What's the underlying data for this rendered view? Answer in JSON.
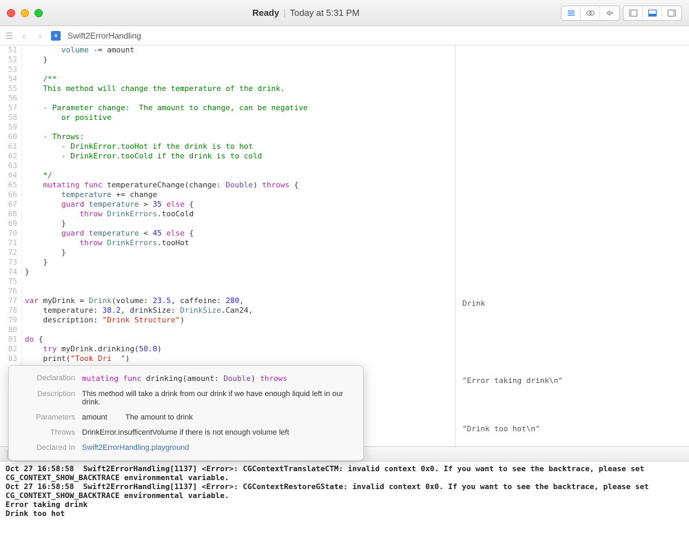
{
  "titlebar": {
    "status": "Ready",
    "time": "Today at 5:31 PM"
  },
  "tab": {
    "filename": "Swift2ErrorHandling"
  },
  "gutter_start": 51,
  "gutter_end": 83,
  "code_lines": [
    {
      "indent": 8,
      "tokens": [
        {
          "t": "volume ",
          "c": "prop"
        },
        {
          "t": "-= amount"
        }
      ]
    },
    {
      "indent": 4,
      "tokens": [
        {
          "t": "}"
        }
      ]
    },
    {
      "indent": 0,
      "tokens": []
    },
    {
      "indent": 4,
      "tokens": [
        {
          "t": "/**",
          "c": "doc"
        }
      ]
    },
    {
      "indent": 4,
      "tokens": [
        {
          "t": "This method will change the temperature of the drink.",
          "c": "doc"
        }
      ]
    },
    {
      "indent": 0,
      "tokens": []
    },
    {
      "indent": 4,
      "tokens": [
        {
          "t": "- Parameter change:  The amount to change, can be negative",
          "c": "doc"
        }
      ]
    },
    {
      "indent": 8,
      "tokens": [
        {
          "t": "or positive",
          "c": "doc"
        }
      ]
    },
    {
      "indent": 0,
      "tokens": []
    },
    {
      "indent": 4,
      "tokens": [
        {
          "t": "- Throws:",
          "c": "doc"
        }
      ]
    },
    {
      "indent": 8,
      "tokens": [
        {
          "t": "- DrinkError.tooHot if the drink is to hot",
          "c": "doc"
        }
      ]
    },
    {
      "indent": 8,
      "tokens": [
        {
          "t": "- DrinkError.tooCold if the drink is to cold",
          "c": "doc"
        }
      ]
    },
    {
      "indent": 0,
      "tokens": []
    },
    {
      "indent": 4,
      "tokens": [
        {
          "t": "*/",
          "c": "doc"
        }
      ]
    },
    {
      "indent": 4,
      "tokens": [
        {
          "t": "mutating func ",
          "c": "kw"
        },
        {
          "t": "temperatureChange(change: "
        },
        {
          "t": "Double",
          "c": "type"
        },
        {
          "t": ") "
        },
        {
          "t": "throws",
          "c": "kw"
        },
        {
          "t": " {"
        }
      ]
    },
    {
      "indent": 8,
      "tokens": [
        {
          "t": "temperature ",
          "c": "prop"
        },
        {
          "t": "+= change"
        }
      ]
    },
    {
      "indent": 8,
      "tokens": [
        {
          "t": "guard ",
          "c": "kw"
        },
        {
          "t": "temperature",
          "c": "prop"
        },
        {
          "t": " > "
        },
        {
          "t": "35",
          "c": "num"
        },
        {
          "t": " "
        },
        {
          "t": "else",
          "c": "kw"
        },
        {
          "t": " {"
        }
      ]
    },
    {
      "indent": 12,
      "tokens": [
        {
          "t": "throw ",
          "c": "kw"
        },
        {
          "t": "DrinkErrors",
          "c": "usertype"
        },
        {
          "t": ".tooCold"
        }
      ]
    },
    {
      "indent": 8,
      "tokens": [
        {
          "t": "}"
        }
      ]
    },
    {
      "indent": 8,
      "tokens": [
        {
          "t": "guard ",
          "c": "kw"
        },
        {
          "t": "temperature",
          "c": "prop"
        },
        {
          "t": " < "
        },
        {
          "t": "45",
          "c": "num"
        },
        {
          "t": " "
        },
        {
          "t": "else",
          "c": "kw"
        },
        {
          "t": " {"
        }
      ]
    },
    {
      "indent": 12,
      "tokens": [
        {
          "t": "throw ",
          "c": "kw"
        },
        {
          "t": "DrinkErrors",
          "c": "usertype"
        },
        {
          "t": ".tooHot"
        }
      ]
    },
    {
      "indent": 8,
      "tokens": [
        {
          "t": "}"
        }
      ]
    },
    {
      "indent": 4,
      "tokens": [
        {
          "t": "}"
        }
      ]
    },
    {
      "indent": 0,
      "tokens": [
        {
          "t": "}"
        }
      ]
    },
    {
      "indent": 0,
      "tokens": []
    },
    {
      "indent": 0,
      "tokens": []
    },
    {
      "indent": 0,
      "tokens": [
        {
          "t": "var ",
          "c": "kw"
        },
        {
          "t": "myDrink = "
        },
        {
          "t": "Drink",
          "c": "usertype"
        },
        {
          "t": "(volume: "
        },
        {
          "t": "23.5",
          "c": "num"
        },
        {
          "t": ", caffeine: "
        },
        {
          "t": "280",
          "c": "num"
        },
        {
          "t": ","
        }
      ]
    },
    {
      "indent": 4,
      "tokens": [
        {
          "t": "temperature: "
        },
        {
          "t": "38.2",
          "c": "num"
        },
        {
          "t": ", drinkSize: "
        },
        {
          "t": "DrinkSize",
          "c": "usertype"
        },
        {
          "t": ".Can24,"
        }
      ]
    },
    {
      "indent": 4,
      "tokens": [
        {
          "t": "description: "
        },
        {
          "t": "\"Drink Structure\"",
          "c": "str"
        },
        {
          "t": ")"
        }
      ]
    },
    {
      "indent": 0,
      "tokens": []
    },
    {
      "indent": 0,
      "tokens": [
        {
          "t": "do ",
          "c": "kw"
        },
        {
          "t": "{"
        }
      ]
    },
    {
      "indent": 4,
      "tokens": [
        {
          "t": "try ",
          "c": "kw"
        },
        {
          "t": "myDrink."
        },
        {
          "t": "drinking",
          "c": "method"
        },
        {
          "t": "("
        },
        {
          "t": "50.0",
          "c": "num"
        },
        {
          "t": ")"
        }
      ]
    },
    {
      "indent": 4,
      "tokens": [
        {
          "t": "print",
          "c": "method"
        },
        {
          "t": "("
        },
        {
          "t": "\"Took Dri  \"",
          "c": "str"
        },
        {
          "t": ")"
        }
      ]
    }
  ],
  "sidebar_results": {
    "r77": "Drink",
    "r85": "\"Error taking drink\\n\"",
    "r90": "\"Drink too hot\\n\""
  },
  "popover": {
    "decl_label": "Declaration",
    "decl_val_tokens": [
      {
        "t": "mutating func ",
        "c": "kw"
      },
      {
        "t": "drinking(amount: "
      },
      {
        "t": "Double",
        "c": "type"
      },
      {
        "t": ") "
      },
      {
        "t": "throws",
        "c": "kw"
      }
    ],
    "desc_label": "Description",
    "desc_val": "This method will take a drink from our drink if we have enough liquid left in our drink.",
    "params_label": "Parameters",
    "param_name": "amount",
    "param_desc": "The amount to drink",
    "throws_label": "Throws",
    "throws_val": "DrinkError.insufficentVolume if there is not enough volume left",
    "declin_label": "Declared In",
    "declin_val": "Swift2ErrorHandling.playground"
  },
  "console_lines": [
    "Oct 27 16:58:58  Swift2ErrorHandling[1137] <Error>: CGContextTranslateCTM: invalid context 0x0. If you want to see the backtrace, please set CG_CONTEXT_SHOW_BACKTRACE environmental variable.",
    "Oct 27 16:58:58  Swift2ErrorHandling[1137] <Error>: CGContextRestoreGState: invalid context 0x0. If you want to see the backtrace, please set CG_CONTEXT_SHOW_BACKTRACE environmental variable.",
    "Error taking drink",
    "Drink too hot"
  ]
}
